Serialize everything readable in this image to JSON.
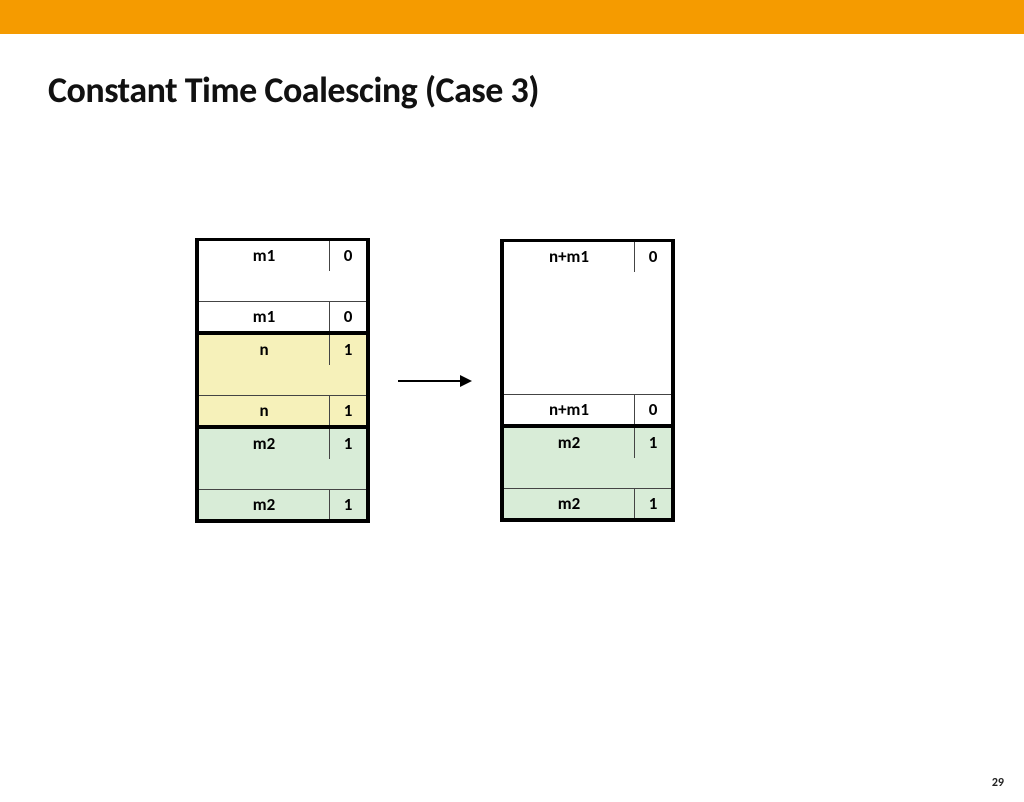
{
  "title": "Constant Time Coalescing (Case 3)",
  "page_number": "29",
  "colors": {
    "accent": "#f59b00",
    "yellow": "#f6f1ba",
    "green": "#d8ecd7"
  },
  "left_block": {
    "seg1": {
      "header": {
        "label": "m1",
        "flag": "0"
      },
      "footer": {
        "label": "m1",
        "flag": "0"
      },
      "fill": "white"
    },
    "seg2": {
      "header": {
        "label": "n",
        "flag": "1"
      },
      "footer": {
        "label": "n",
        "flag": "1"
      },
      "fill": "yellow"
    },
    "seg3": {
      "header": {
        "label": "m2",
        "flag": "1"
      },
      "footer": {
        "label": "m2",
        "flag": "1"
      },
      "fill": "green"
    }
  },
  "right_block": {
    "seg1": {
      "header": {
        "label": "n+m1",
        "flag": "0"
      },
      "footer": {
        "label": "n+m1",
        "flag": "0"
      },
      "fill": "white",
      "tall": true
    },
    "seg2": {
      "header": {
        "label": "m2",
        "flag": "1"
      },
      "footer": {
        "label": "m2",
        "flag": "1"
      },
      "fill": "green"
    }
  }
}
